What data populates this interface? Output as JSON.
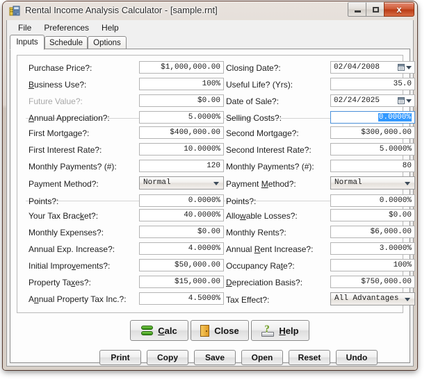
{
  "window": {
    "title": "Rental Income Analysis Calculator  - [sample.rnt]",
    "app_icon": "building-calculator-icon",
    "controls": {
      "minimize": "minimize-icon",
      "maximize": "maximize-icon",
      "close": "x"
    }
  },
  "menubar": {
    "items": [
      "File",
      "Preferences",
      "Help"
    ]
  },
  "tabs": [
    {
      "label": "Inputs",
      "active": true
    },
    {
      "label": "Schedule",
      "active": false
    },
    {
      "label": "Options",
      "active": false
    }
  ],
  "form": {
    "section1": {
      "left": [
        {
          "label_pre": "Purchase Price?:",
          "accel": "",
          "label_post": "",
          "value": "$1,000,000.00",
          "type": "text",
          "disabled": false
        },
        {
          "label_pre": "",
          "accel": "B",
          "label_post": "usiness Use?:",
          "value": "100%",
          "type": "text",
          "disabled": false
        },
        {
          "label_pre": "Future Value?:",
          "accel": "",
          "label_post": "",
          "value": "$0.00",
          "type": "text",
          "disabled": true
        },
        {
          "label_pre": "",
          "accel": "A",
          "label_post": "nnual Appreciation?:",
          "value": "5.0000%",
          "type": "text",
          "disabled": false
        }
      ],
      "right": [
        {
          "label_pre": "Closing Date?:",
          "accel": "",
          "label_post": "",
          "value": "02/04/2008",
          "type": "date",
          "disabled": false
        },
        {
          "label_pre": "Useful Life? (Yrs):",
          "accel": "",
          "label_post": "",
          "value": "35.0",
          "type": "text",
          "disabled": false
        },
        {
          "label_pre": "Date of Sale?:",
          "accel": "",
          "label_post": "",
          "value": "02/24/2025",
          "type": "date",
          "disabled": false
        },
        {
          "label_pre": "Selling Costs?:",
          "accel": "",
          "label_post": "",
          "value": "0.0000%",
          "type": "text",
          "disabled": false,
          "focused": true,
          "selected": true
        }
      ]
    },
    "section2": {
      "left": [
        {
          "label_pre": "First Mortgage?:",
          "accel": "",
          "label_post": "",
          "value": "$400,000.00",
          "type": "text",
          "disabled": false
        },
        {
          "label_pre": "First Interest Rate?:",
          "accel": "",
          "label_post": "",
          "value": "10.0000%",
          "type": "text",
          "disabled": false
        },
        {
          "label_pre": "Monthly Payments? (#):",
          "accel": "",
          "label_post": "",
          "value": "120",
          "type": "text",
          "disabled": false
        },
        {
          "label_pre": "Payment Method?:",
          "accel": "",
          "label_post": "",
          "value": "Normal",
          "type": "combo",
          "disabled": false
        },
        {
          "label_pre": "Points?:",
          "accel": "",
          "label_post": "",
          "value": "0.0000%",
          "type": "text",
          "disabled": false
        }
      ],
      "right": [
        {
          "label_pre": "Second Mort",
          "accel": "g",
          "label_post": "age?:",
          "value": "$300,000.00",
          "type": "text",
          "disabled": false
        },
        {
          "label_pre": "Second Interest Rate?:",
          "accel": "",
          "label_post": "",
          "value": "5.0000%",
          "type": "text",
          "disabled": false
        },
        {
          "label_pre": "Monthly Payments? (#):",
          "accel": "",
          "label_post": "",
          "value": "80",
          "type": "text",
          "disabled": false
        },
        {
          "label_pre": "Payment ",
          "accel": "M",
          "label_post": "ethod?:",
          "value": "Normal",
          "type": "combo",
          "disabled": false
        },
        {
          "label_pre": "Points?:",
          "accel": "",
          "label_post": "",
          "value": "0.0000%",
          "type": "text",
          "disabled": false
        }
      ]
    },
    "section3": {
      "left": [
        {
          "label_pre": "Your Tax Brac",
          "accel": "k",
          "label_post": "et?:",
          "value": "40.0000%",
          "type": "text",
          "disabled": false
        },
        {
          "label_pre": "Monthly Expenses?:",
          "accel": "",
          "label_post": "",
          "value": "$0.00",
          "type": "text",
          "disabled": false
        },
        {
          "label_pre": "Annual Exp. Increase?:",
          "accel": "",
          "label_post": "",
          "value": "4.0000%",
          "type": "text",
          "disabled": false
        },
        {
          "label_pre": "Initial Impro",
          "accel": "v",
          "label_post": "ements?:",
          "value": "$50,000.00",
          "type": "text",
          "disabled": false
        },
        {
          "label_pre": "Property Ta",
          "accel": "x",
          "label_post": "es?:",
          "value": "$15,000.00",
          "type": "text",
          "disabled": false
        },
        {
          "label_pre": "A",
          "accel": "n",
          "label_post": "nual Property Tax Inc.?:",
          "value": "4.5000%",
          "type": "text",
          "disabled": false
        }
      ],
      "right": [
        {
          "label_pre": "Allo",
          "accel": "w",
          "label_post": "able Losses?:",
          "value": "$0.00",
          "type": "text",
          "disabled": false
        },
        {
          "label_pre": "Monthly Rents?:",
          "accel": "",
          "label_post": "",
          "value": "$6,000.00",
          "type": "text",
          "disabled": false
        },
        {
          "label_pre": "Annual ",
          "accel": "R",
          "label_post": "ent Increase?:",
          "value": "3.0000%",
          "type": "text",
          "disabled": false
        },
        {
          "label_pre": "Occupancy Ra",
          "accel": "t",
          "label_post": "e?:",
          "value": "100%",
          "type": "text",
          "disabled": false
        },
        {
          "label_pre": "",
          "accel": "D",
          "label_post": "epreciation Basis?:",
          "value": "$750,000.00",
          "type": "text",
          "disabled": false
        },
        {
          "label_pre": "Tax Effect?:",
          "accel": "",
          "label_post": "",
          "value": "All Advantages",
          "type": "combo",
          "disabled": false
        }
      ]
    }
  },
  "actions": {
    "primary": [
      {
        "pre": "",
        "accel": "C",
        "post": "alc",
        "icon": "calc-stack-icon"
      },
      {
        "pre": "Close",
        "accel": "",
        "post": "",
        "icon": "door-icon"
      },
      {
        "pre": "",
        "accel": "H",
        "post": "elp",
        "icon": "help-book-icon"
      }
    ],
    "secondary": [
      "Print",
      "Copy",
      "Save",
      "Open",
      "Reset",
      "Undo"
    ]
  },
  "colors": {
    "accent": "#3399ff",
    "focus_border": "#4a90d9",
    "close_button": "#b93c16",
    "calc_icon": "#2f8a11",
    "door_icon": "#e09a22",
    "help_icon": "#6f9b2a"
  }
}
